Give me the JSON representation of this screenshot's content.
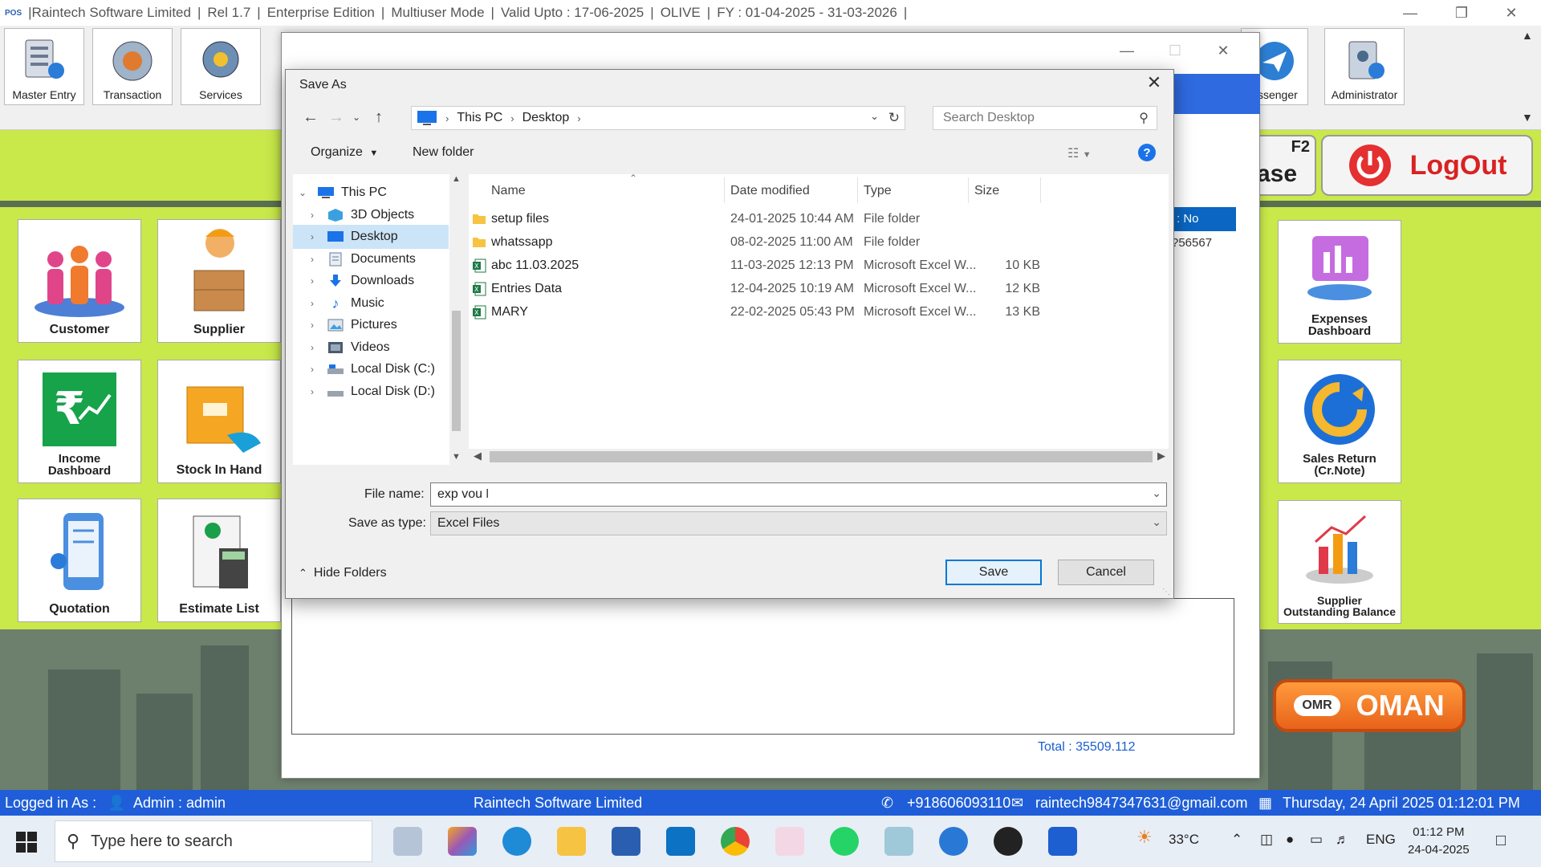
{
  "app": {
    "logo": "POS",
    "title_segments": [
      "|Raintech Software Limited",
      "Rel 1.7",
      "Enterprise Edition",
      "Multiuser Mode",
      "Valid Upto : 17-06-2025",
      "OLIVE",
      "FY : 01-04-2025  -  31-03-2026",
      ""
    ]
  },
  "toolbar": {
    "buttons": [
      {
        "label": "Master Entry",
        "icon": "master-entry-icon"
      },
      {
        "label": "Transaction",
        "icon": "transaction-icon"
      },
      {
        "label": "Services",
        "icon": "services-icon"
      },
      {
        "label": "essenger",
        "icon": "messenger-icon"
      },
      {
        "label": "Administrator",
        "icon": "administrator-icon"
      }
    ]
  },
  "tiles": [
    {
      "label": "Customer",
      "icon": "customer-icon"
    },
    {
      "label": "Supplier",
      "icon": "supplier-icon"
    },
    {
      "label": "Income\nDashboard",
      "icon": "income-dashboard-icon"
    },
    {
      "label": "Stock In Hand",
      "icon": "stock-in-hand-icon"
    },
    {
      "label": "Quotation",
      "icon": "quotation-icon"
    },
    {
      "label": "Estimate List",
      "icon": "estimate-list-icon"
    },
    {
      "label": "Expenses\nDashboard",
      "icon": "expenses-dashboard-icon"
    },
    {
      "label": "Sales Return\n(Cr.Note)",
      "icon": "sales-return-icon"
    },
    {
      "label": "Supplier\nOutstanding Balance",
      "icon": "supplier-outstanding-icon"
    }
  ],
  "right_panel": {
    "f2_label": "F2",
    "f2_text": "ase",
    "logout_label": "LogOut",
    "currency_code": "OMR",
    "currency_name": "OMAN"
  },
  "under_window": {
    "no_header": ": No",
    "phone_partial": "?56567",
    "total": "Total : 35509.112"
  },
  "dialog": {
    "title": "Save As",
    "address": {
      "root": "This PC",
      "folder": "Desktop"
    },
    "search_placeholder": "Search Desktop",
    "organize_label": "Organize",
    "new_folder_label": "New folder",
    "tree": [
      {
        "label": "This PC",
        "icon": "this-pc-icon",
        "expanded": true
      },
      {
        "label": "3D Objects",
        "icon": "3d-objects-icon"
      },
      {
        "label": "Desktop",
        "icon": "desktop-icon",
        "selected": true
      },
      {
        "label": "Documents",
        "icon": "documents-icon"
      },
      {
        "label": "Downloads",
        "icon": "downloads-icon"
      },
      {
        "label": "Music",
        "icon": "music-icon"
      },
      {
        "label": "Pictures",
        "icon": "pictures-icon"
      },
      {
        "label": "Videos",
        "icon": "videos-icon"
      },
      {
        "label": "Local Disk (C:)",
        "icon": "local-disk-icon"
      },
      {
        "label": "Local Disk (D:)",
        "icon": "local-disk-icon"
      }
    ],
    "columns": [
      "Name",
      "Date modified",
      "Type",
      "Size"
    ],
    "files": [
      {
        "name": "setup files",
        "date": "24-01-2025 10:44 AM",
        "type": "File folder",
        "size": "",
        "icon": "folder-icon"
      },
      {
        "name": "whatssapp",
        "date": "08-02-2025 11:00 AM",
        "type": "File folder",
        "size": "",
        "icon": "folder-icon"
      },
      {
        "name": "abc 11.03.2025",
        "date": "11-03-2025 12:13 PM",
        "type": "Microsoft Excel W...",
        "size": "10 KB",
        "icon": "excel-file-icon"
      },
      {
        "name": "Entries Data",
        "date": "12-04-2025 10:19 AM",
        "type": "Microsoft Excel W...",
        "size": "12 KB",
        "icon": "excel-file-icon"
      },
      {
        "name": "MARY",
        "date": "22-02-2025 05:43 PM",
        "type": "Microsoft Excel W...",
        "size": "13 KB",
        "icon": "excel-file-icon"
      }
    ],
    "file_name_label": "File name:",
    "file_name_value": "exp vou",
    "save_type_label": "Save as type:",
    "save_type_value": "Excel Files",
    "hide_folders_label": "Hide Folders",
    "save_label": "Save",
    "cancel_label": "Cancel"
  },
  "statusbar": {
    "logged_in": "Logged in As :",
    "user": "Admin  :  admin",
    "company": "Raintech Software Limited",
    "phone": "+918606093110",
    "email": "raintech9847347631@gmail.com",
    "datetime": "Thursday, 24 April 2025 01:12:01 PM"
  },
  "taskbar": {
    "search_placeholder": "Type here to search",
    "temperature": "33°C",
    "language": "ENG",
    "time": "01:12 PM",
    "date": "24-04-2025"
  },
  "colors": {
    "accent_blue": "#1f5ed8",
    "logout_red": "#d92222",
    "background_green": "#c9e84a",
    "selection_blue": "#cce4f7"
  }
}
